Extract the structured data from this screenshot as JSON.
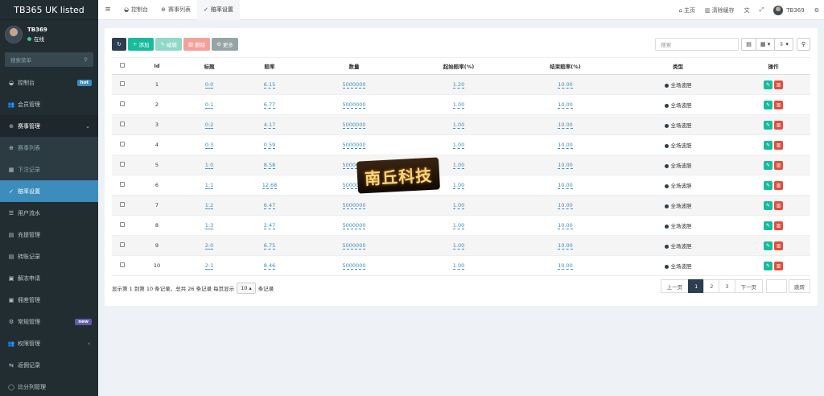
{
  "sidebar": {
    "brand": "TB365 UK listed",
    "user": {
      "name": "TB369",
      "status": "在线"
    },
    "search_placeholder": "搜索菜单",
    "items": [
      {
        "icon": "dashboard-icon",
        "label": "控制台",
        "badge": "hot"
      },
      {
        "icon": "users-icon",
        "label": "会员管理"
      },
      {
        "icon": "event-icon",
        "label": "赛事管理",
        "caret": "⌄"
      },
      {
        "icon": "list-icon",
        "label": "赛事列表"
      },
      {
        "icon": "record-icon",
        "label": "下注记录"
      },
      {
        "icon": "odds-icon",
        "label": "赔率设置"
      },
      {
        "icon": "flow-icon",
        "label": "用户流水"
      },
      {
        "icon": "deposit-icon",
        "label": "充提管理"
      },
      {
        "icon": "transfer-icon",
        "label": "转账记录"
      },
      {
        "icon": "unfreeze-icon",
        "label": "解冻申请"
      },
      {
        "icon": "bonus-icon",
        "label": "佣差管理"
      },
      {
        "icon": "settings-icon",
        "label": "常规管理",
        "badge": "new"
      },
      {
        "icon": "permission-icon",
        "label": "权限管理",
        "caret": "‹"
      },
      {
        "icon": "rebate-icon",
        "label": "返佣记录"
      },
      {
        "icon": "score-icon",
        "label": "比分列管理"
      }
    ]
  },
  "topbar": {
    "tabs": [
      {
        "icon": "dashboard-icon",
        "label": "控制台"
      },
      {
        "icon": "event-icon",
        "label": "赛事列表"
      },
      {
        "icon": "odds-icon",
        "label": "赔率设置"
      }
    ],
    "home": "主页",
    "clear_cache": "清除缓存",
    "username": "TB369"
  },
  "toolbar": {
    "add": "添加",
    "edit": "编辑",
    "delete": "删除",
    "more": "更多",
    "search_placeholder": "搜索"
  },
  "table": {
    "headers": [
      "Id",
      "标题",
      "赔率",
      "数量",
      "起始赔率(%)",
      "结束赔率(%)",
      "类型",
      "操作"
    ],
    "rows": [
      {
        "id": "1",
        "title": "0:0",
        "odds": "6.15",
        "qty": "5000000",
        "start": "1.20",
        "end": "10.00",
        "type": "全场波胆"
      },
      {
        "id": "2",
        "title": "0:1",
        "odds": "6.77",
        "qty": "5000000",
        "start": "1.00",
        "end": "10.00",
        "type": "全场波胆"
      },
      {
        "id": "3",
        "title": "0:2",
        "odds": "4.17",
        "qty": "5000000",
        "start": "1.00",
        "end": "10.00",
        "type": "全场波胆"
      },
      {
        "id": "4",
        "title": "0:3",
        "odds": "0.59",
        "qty": "5000000",
        "start": "1.00",
        "end": "10.00",
        "type": "全场波胆"
      },
      {
        "id": "5",
        "title": "1:0",
        "odds": "8.58",
        "qty": "5000000",
        "start": "1.00",
        "end": "10.00",
        "type": "全场波胆"
      },
      {
        "id": "6",
        "title": "1:1",
        "odds": "12.68",
        "qty": "5000000",
        "start": "1.00",
        "end": "10.00",
        "type": "全场波胆"
      },
      {
        "id": "7",
        "title": "1:2",
        "odds": "6.47",
        "qty": "5000000",
        "start": "1.00",
        "end": "10.00",
        "type": "全场波胆"
      },
      {
        "id": "8",
        "title": "1:3",
        "odds": "2.47",
        "qty": "5000000",
        "start": "1.00",
        "end": "10.00",
        "type": "全场波胆"
      },
      {
        "id": "9",
        "title": "2:0",
        "odds": "6.75",
        "qty": "5000000",
        "start": "1.00",
        "end": "10.00",
        "type": "全场波胆"
      },
      {
        "id": "10",
        "title": "2:1",
        "odds": "8.46",
        "qty": "5000000",
        "start": "1.00",
        "end": "10.00",
        "type": "全场波胆"
      }
    ]
  },
  "footer": {
    "summary": "显示第 1 到第 10 条记录，总共 26 条记录 每页显示",
    "page_size": "10",
    "suffix": "条记录",
    "prev": "上一页",
    "pages": [
      "1",
      "2",
      "3"
    ],
    "next": "下一页",
    "go": "跳转"
  },
  "watermark": "南丘科技"
}
